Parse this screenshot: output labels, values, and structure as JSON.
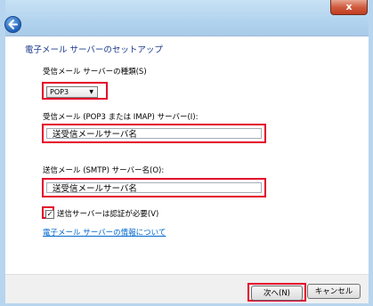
{
  "window": {
    "close_label": "x"
  },
  "wizard": {
    "title": "電子メール サーバーのセットアップ",
    "incoming_type_label": "受信メール サーバーの種類(S)",
    "incoming_type_value": "POP3",
    "incoming_server_label": "受信メール (POP3 または IMAP) サーバー(I):",
    "incoming_server_value": "送受信メールサーバ名",
    "outgoing_server_label": "送信メール (SMTP) サーバー名(O):",
    "outgoing_server_value": "送受信メールサーバ名",
    "auth_checkbox_label": "送信サーバーは認証が必要(V)",
    "auth_checked": true,
    "info_link": "電子メール サーバーの情報について"
  },
  "footer": {
    "next_label": "次へ(N)",
    "cancel_label": "キャンセル"
  },
  "colors": {
    "highlight": "#e4002b",
    "title_text": "#1b3b8c",
    "link": "#0066cc"
  }
}
